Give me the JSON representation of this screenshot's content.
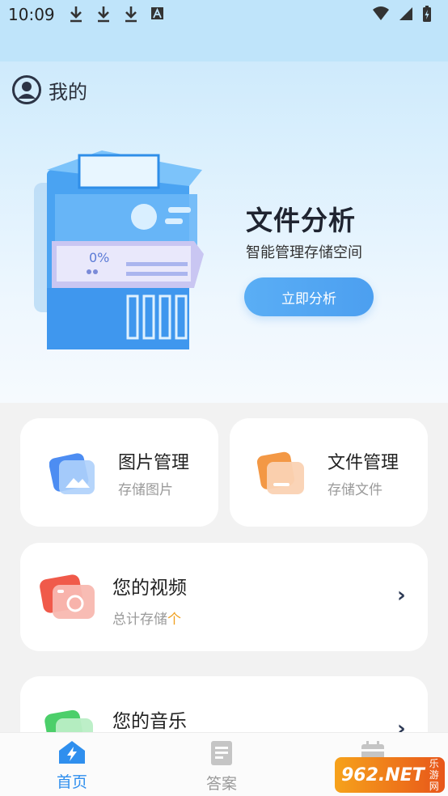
{
  "status_bar": {
    "time": "10:09",
    "icons": [
      "download-icon",
      "download-icon",
      "download-icon",
      "a-icon",
      "wifi-icon",
      "signal-icon",
      "battery-charging-icon"
    ]
  },
  "profile": {
    "label": "我的",
    "icon": "user-circle-icon"
  },
  "hero": {
    "title": "文件分析",
    "subtitle": "智能管理存储空间",
    "button_label": "立即分析",
    "illustration_text": "0%"
  },
  "cards": {
    "images": {
      "title": "图片管理",
      "subtitle": "存储图片",
      "icon": "image-folder-icon"
    },
    "files": {
      "title": "文件管理",
      "subtitle": "存储文件",
      "icon": "file-folder-icon"
    },
    "videos": {
      "title": "您的视频",
      "subtitle_prefix": "总计存储",
      "subtitle_suffix": "个",
      "icon": "camera-icon"
    },
    "music": {
      "title": "您的音乐",
      "icon": "music-icon"
    }
  },
  "bottom_nav": {
    "items": [
      {
        "label": "首页",
        "icon": "home-bolt-icon",
        "active": true
      },
      {
        "label": "答案",
        "icon": "document-icon",
        "active": false
      },
      {
        "label": "",
        "icon": "calendar-icon",
        "active": false
      }
    ]
  },
  "watermark": {
    "main": "962.NET",
    "side": "乐游网"
  },
  "colors": {
    "accent": "#4c9ff0",
    "active_tab": "#2f8fee",
    "orange": "#f0a020"
  }
}
